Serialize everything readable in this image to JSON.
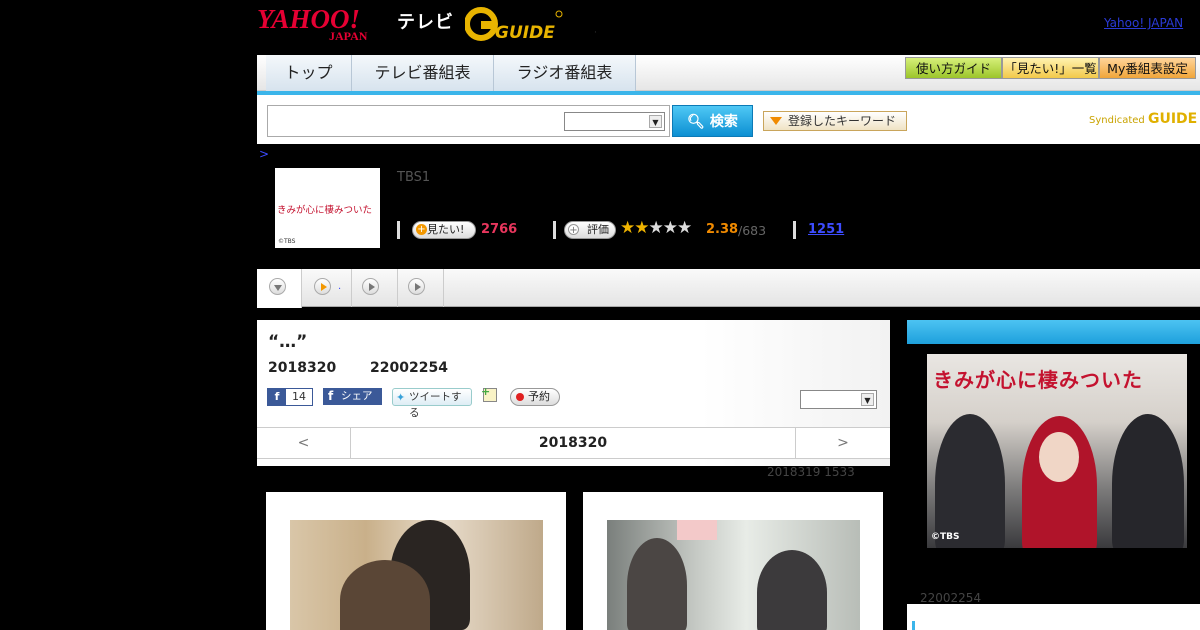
{
  "header": {
    "yahoo_logo": "YAHOO! JAPAN",
    "tv_label": "テレビ",
    "gguide_logo": "G GUIDE",
    "yahoo_japan_link": "Yahoo! JAPAN"
  },
  "nav": {
    "tabs": [
      {
        "label": "トップ"
      },
      {
        "label": "テレビ番組表"
      },
      {
        "label": "ラジオ番組表"
      }
    ],
    "right_buttons": [
      {
        "label": "使い方ガイド"
      },
      {
        "label": "「見たい!」一覧"
      },
      {
        "label": "My番組表設定"
      }
    ]
  },
  "search": {
    "placeholder": "",
    "button_label": "検索",
    "keyword_button": "登録したキーワード",
    "syndicated": "Syndicated",
    "syndicated_brand": "GUIDE"
  },
  "breadcrumb": ">",
  "program": {
    "thumb_title": "きみが心に棲みついた",
    "thumb_copyright": "©TBS",
    "channel": "TBS1",
    "mitai_label": "見たい!",
    "mitai_count": "2766",
    "hyoka_label": "評価",
    "stars_on": 2,
    "stars_total": 5,
    "score": "2.38",
    "score_count": "/683",
    "link_count": "1251"
  },
  "tabstrip": {
    "dot": "."
  },
  "article": {
    "title": "“…”",
    "date": "2018320",
    "id": "22002254",
    "fb_icon": "f",
    "fb_count": "14",
    "fb_share_label": "シェア",
    "tweet_label": "ツイートする",
    "yoyaku_label": "予約",
    "pager": {
      "prev": "<",
      "date": "2018320",
      "next": ">"
    },
    "updated": "2018319  1533"
  },
  "sidebar": {
    "image_title": "きみが心に棲みついた",
    "image_copyright": "©TBS",
    "id": "22002254"
  },
  "colors": {
    "accent_blue": "#1ea0dc",
    "mitai_pink": "#e8365d",
    "score_orange": "#f08a00",
    "link_blue": "#3d4cff"
  }
}
